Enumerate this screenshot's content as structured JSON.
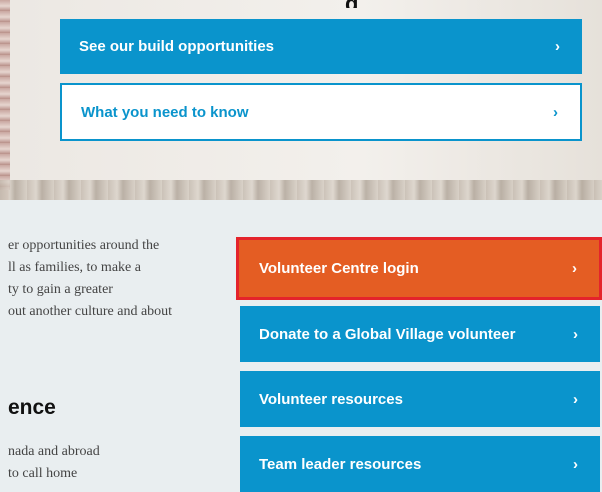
{
  "hero": {
    "heading_fragment": "g"
  },
  "buttons": {
    "build_opportunities": "See our build opportunities",
    "need_to_know": "What you need to know",
    "volunteer_login": "Volunteer Centre login",
    "donate": "Donate to a Global Village volunteer",
    "volunteer_resources": "Volunteer resources",
    "team_leader": "Team leader resources",
    "chevron": "›"
  },
  "intro": {
    "lines": [
      "er opportunities around the",
      "ll as families, to make a",
      "ty to gain a greater",
      "out another culture and about"
    ]
  },
  "section": {
    "heading": "ence",
    "lines": [
      "nada and abroad",
      "to call home"
    ]
  },
  "colors": {
    "brand_blue": "#0a94cc",
    "login_orange": "#e45d23",
    "highlight_red": "#e4232b"
  }
}
